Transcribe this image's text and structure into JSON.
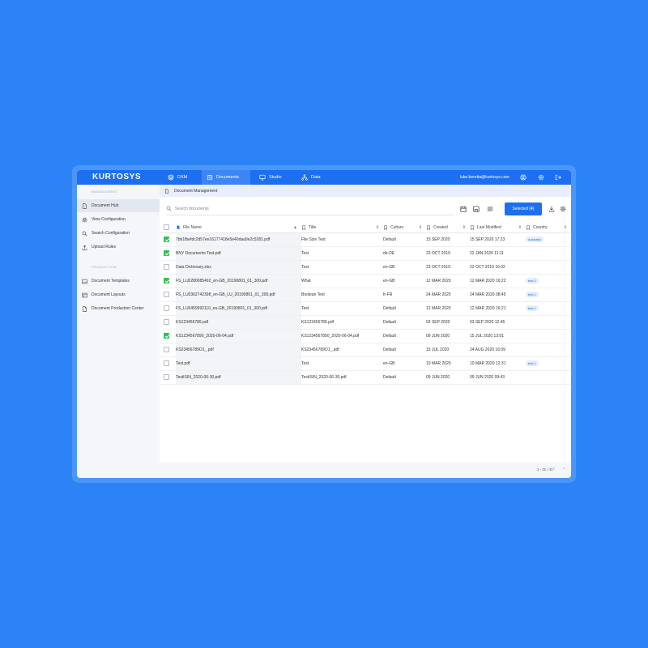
{
  "app": {
    "logo": "KURTOSYS",
    "nav": [
      {
        "label": "DXM",
        "icon": "layers-icon"
      },
      {
        "label": "Documents",
        "icon": "documents-icon"
      },
      {
        "label": "Studio",
        "icon": "monitor-icon"
      },
      {
        "label": "Data",
        "icon": "network-icon"
      }
    ],
    "user_email": "luke.beretta@kurtosys.com"
  },
  "sidebar": {
    "management_heading": "MANAGEMENT",
    "management_items": [
      {
        "label": "Document Hub",
        "icon": "document-icon"
      },
      {
        "label": "View Configuration",
        "icon": "gear-icon"
      },
      {
        "label": "Search Configuration",
        "icon": "search-icon"
      },
      {
        "label": "Upload Rules",
        "icon": "upload-icon"
      }
    ],
    "production_heading": "PRODUCTION",
    "production_items": [
      {
        "label": "Document Templates",
        "icon": "image-icon"
      },
      {
        "label": "Document Layouts",
        "icon": "layout-icon"
      },
      {
        "label": "Document Production Center",
        "icon": "file-icon"
      }
    ]
  },
  "breadcrumb": "Document Management",
  "toolbar": {
    "search_placeholder": "Search documents",
    "selected_label": "Selected (4)"
  },
  "table": {
    "headers": {
      "file_name": "File Name",
      "title": "Title",
      "culture": "Culture",
      "created": "Created",
      "last_modified": "Last Modified",
      "country": "Country"
    },
    "rows": [
      {
        "checked": true,
        "file_name": "7bb1fbefdc2d57ee16177418e5e40daa9e2c5281.pdf",
        "title": "File Size Test",
        "culture": "Default",
        "created": "15 SEP 2020",
        "modified": "15 SEP 2020 17:23",
        "country": "Australia"
      },
      {
        "checked": true,
        "file_name": "BNY Documents Test.pdf",
        "title": "Test",
        "culture": "de-DE",
        "created": "23 OCT 2019",
        "modified": "22 JAN 2020 11:11",
        "country": ""
      },
      {
        "checked": false,
        "file_name": "Data Dictionary.xlsx",
        "title": "Test",
        "culture": "en-GB",
        "created": "23 OCT 2019",
        "modified": "23 OCT 2019 16:02",
        "country": ""
      },
      {
        "checked": true,
        "file_name": "FS_LU0280085492_en-GB_20190801_01_300.pdf",
        "title": "What",
        "culture": "en-GB",
        "created": "12 MAR 2020",
        "modified": "12 MAR 2020 16:22",
        "country": "test 2"
      },
      {
        "checked": false,
        "file_name": "FS_LU0362742398_en-GB_LU_20190801_01_300.pdf",
        "title": "Boolean Test",
        "culture": "fr-FR",
        "created": "24 MAR 2020",
        "modified": "24 MAR 2020 08:45",
        "country": "test 1"
      },
      {
        "checked": false,
        "file_name": "FS_LU0459992110_en-GB_20190801_01_300.pdf",
        "title": "Test",
        "culture": "Default",
        "created": "12 MAR 2020",
        "modified": "12 MAR 2020 16:21",
        "country": "test 1"
      },
      {
        "checked": false,
        "file_name": "KS123456789.pdf",
        "title": "KS123456789.pdf",
        "culture": "Default",
        "created": "03 SEP 2020",
        "modified": "03 SEP 2020 12:45",
        "country": ""
      },
      {
        "checked": true,
        "file_name": "KS1234567890_2020-06-04.pdf",
        "title": "KS1234567890_2020-06-04.pdf",
        "culture": "Default",
        "created": "09 JUN 2020",
        "modified": "15 JUL 2020 13:01",
        "country": ""
      },
      {
        "checked": false,
        "file_name": "KS23456789O1_.pdf",
        "title": "KS23456789O1_.pdf",
        "culture": "Default",
        "created": "15 JUL 2020",
        "modified": "24 AUG 2020 16:09",
        "country": ""
      },
      {
        "checked": false,
        "file_name": "Test.pdf",
        "title": "Test",
        "culture": "en-GB",
        "created": "10 MAR 2020",
        "modified": "10 MAR 2020 12:31",
        "country": "test 1"
      },
      {
        "checked": false,
        "file_name": "TestISIN_2020-06-30.pdf",
        "title": "TestISIN_2020-06-30.pdf",
        "culture": "Default",
        "created": "09 JUN 2020",
        "modified": "09 JUN 2020 09:43",
        "country": ""
      }
    ]
  },
  "pagination": {
    "label": "1 - 11 / 11"
  },
  "colors": {
    "accent": "#1d6ff2",
    "background": "#2b83f6",
    "check": "#2fbf55"
  }
}
